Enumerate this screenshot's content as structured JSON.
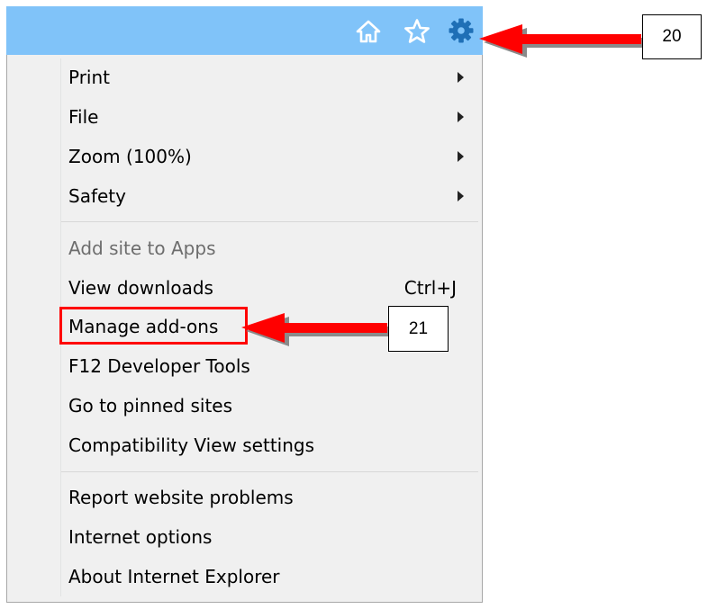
{
  "toolbar": {
    "icons": [
      "home-icon",
      "star-icon",
      "gear-icon"
    ],
    "background": "#80c3f9",
    "icon_color": "#ffffff",
    "gear_color": "#1f6fb6"
  },
  "menu": {
    "items": [
      {
        "label": "Print",
        "submenu": true
      },
      {
        "label": "File",
        "submenu": true
      },
      {
        "label": "Zoom (100%)",
        "submenu": true
      },
      {
        "label": "Safety",
        "submenu": true
      },
      {
        "label": "Add site to Apps",
        "disabled": true
      },
      {
        "label": "View downloads",
        "shortcut": "Ctrl+J"
      },
      {
        "label": "Manage add-ons",
        "highlighted": true
      },
      {
        "label": "F12 Developer Tools"
      },
      {
        "label": "Go to pinned sites"
      },
      {
        "label": "Compatibility View settings"
      },
      {
        "label": "Report website problems"
      },
      {
        "label": "Internet options"
      },
      {
        "label": "About Internet Explorer"
      }
    ]
  },
  "annotations": {
    "step_20": "20",
    "step_21": "21",
    "arrow_color": "#ff0000",
    "highlight_color": "#ff0000"
  }
}
